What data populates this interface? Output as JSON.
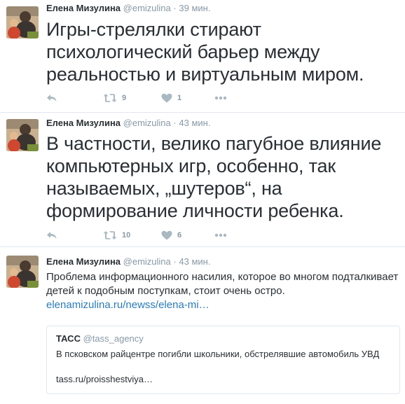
{
  "tweets": [
    {
      "name": "Елена Мизулина",
      "handle": "@emizulina",
      "dot": "·",
      "time": "39 мин.",
      "text": "Игры-стрелялки стирают психологический барьер между реальностью и виртуальным миром.",
      "retweets": "9",
      "likes": "1"
    },
    {
      "name": "Елена Мизулина",
      "handle": "@emizulina",
      "dot": "·",
      "time": "43 мин.",
      "text": "В частности, велико пагубное влияние компьютерных игр, особенно, так называемых, „шутеров“, на формирование личности ребенка.",
      "retweets": "10",
      "likes": "6"
    },
    {
      "name": "Елена Мизулина",
      "handle": "@emizulina",
      "dot": "·",
      "time": "43 мин.",
      "text": "Проблема информационного насилия, которое во многом подталкивает детей к подобным поступкам, стоит очень остро.",
      "link": "elenamizulina.ru/newss/elena-mi…",
      "quote": {
        "name": "ТАСС",
        "handle": "@tass_agency",
        "text": "В псковском райцентре погибли школьники, обстрелявшие автомобиль УВД",
        "link": "tass.ru/proisshestviya…"
      }
    }
  ],
  "icons": {
    "reply": "reply-icon",
    "retweet": "retweet-icon",
    "like": "heart-icon",
    "more": "more-icon"
  },
  "colors": {
    "text": "#292f33",
    "muted": "#8899a6",
    "icon": "#aab8c2",
    "link": "#2b7bb9",
    "border": "#e1e8ed"
  }
}
